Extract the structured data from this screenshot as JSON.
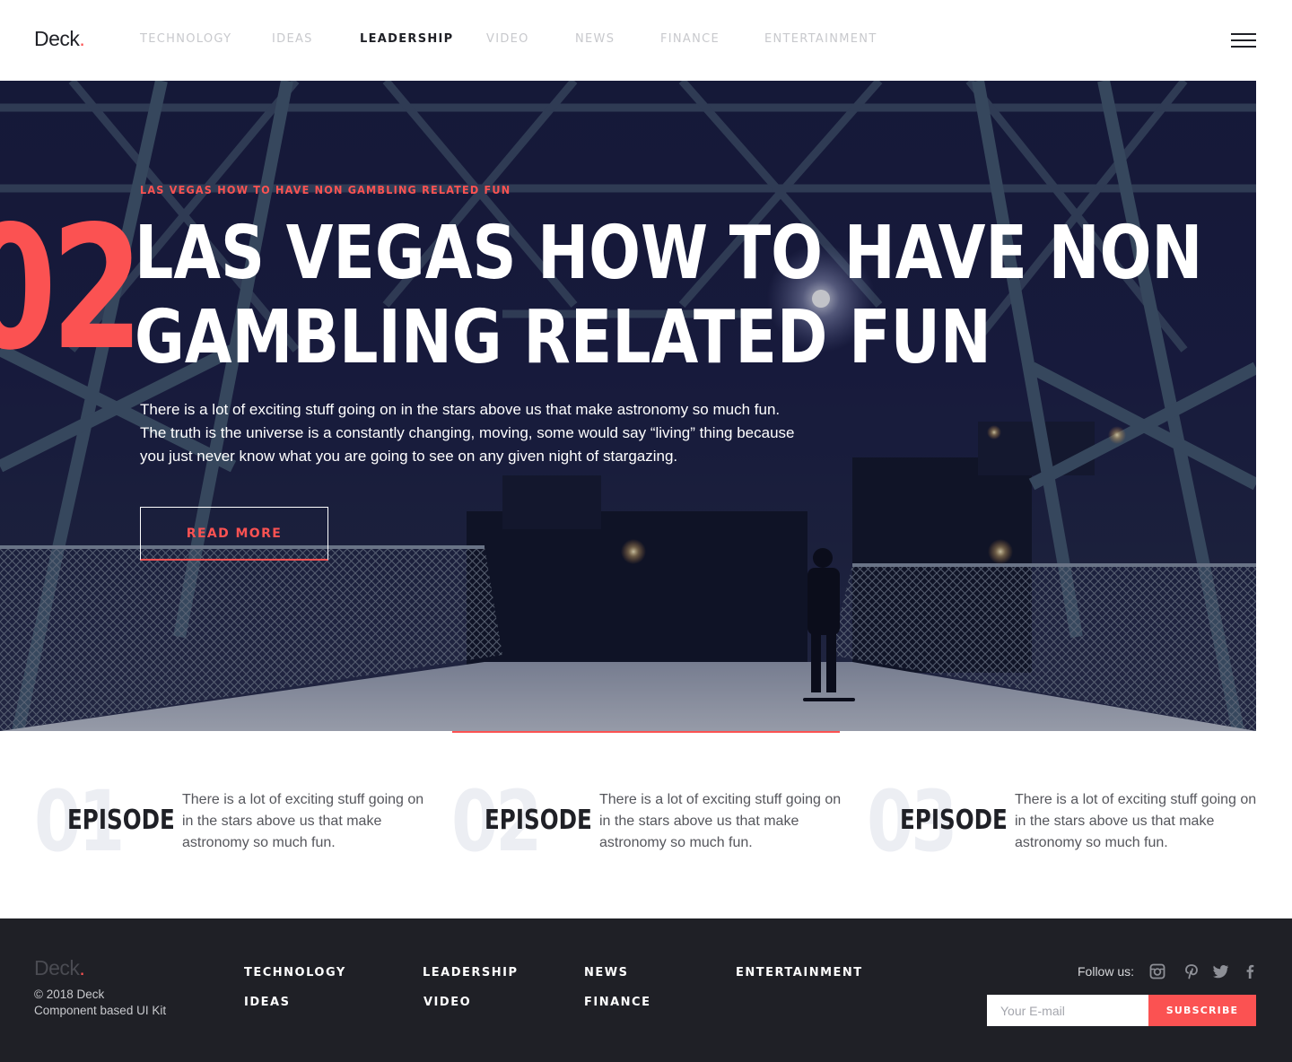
{
  "brand": {
    "name": "Deck",
    "dot": "."
  },
  "nav": {
    "items": [
      "TECHNOLOGY",
      "IDEAS",
      "LEADERSHIP",
      "VIDEO",
      "NEWS",
      "FINANCE",
      "ENTERTAINMENT"
    ],
    "active": "LEADERSHIP",
    "menu_icon": "hamburger-menu-icon"
  },
  "hero": {
    "kicker": "LAS VEGAS HOW TO HAVE NON GAMBLING RELATED FUN",
    "number": "02",
    "title_line1": "LAS VEGAS HOW TO HAVE NON",
    "title_line2": "GAMBLING RELATED FUN",
    "body": "There is a lot of exciting stuff going on in the stars above us that make astronomy so much fun. The truth is the universe is a constantly changing, moving, some would say “living” thing because you just never know what you are going to see on any given night of stargazing.",
    "cta": "READ MORE"
  },
  "episodes": [
    {
      "number": "01",
      "label": "EPISODE",
      "text": "There is a lot of exciting stuff going on in the stars above us that make astronomy so much fun."
    },
    {
      "number": "02",
      "label": "EPISODE",
      "text": "There is a lot of exciting stuff going on in the stars above us that make astronomy so much fun."
    },
    {
      "number": "03",
      "label": "EPISODE",
      "text": "There is a lot of exciting stuff going on in the stars above us that make astronomy so much fun."
    }
  ],
  "footer": {
    "brand": "Deck",
    "copyright": "© 2018 Deck",
    "tagline": "Component based UI Kit",
    "links": {
      "technology": "TECHNOLOGY",
      "ideas": "IDEAS",
      "leadership": "LEADERSHIP",
      "video": "VIDEO",
      "news": "NEWS",
      "finance": "FINANCE",
      "entertainment": "ENTERTAINMENT"
    },
    "follow_label": "Follow us:",
    "social_icons": [
      "instagram-icon",
      "pinterest-icon",
      "twitter-icon",
      "facebook-icon"
    ],
    "email_placeholder": "Your E-mail",
    "subscribe_label": "SUBSCRIBE"
  },
  "colors": {
    "accent": "#fb5252",
    "dark": "#1f2026",
    "muted_nav": "#c8c9cd",
    "episode_number": "#eceef3"
  }
}
